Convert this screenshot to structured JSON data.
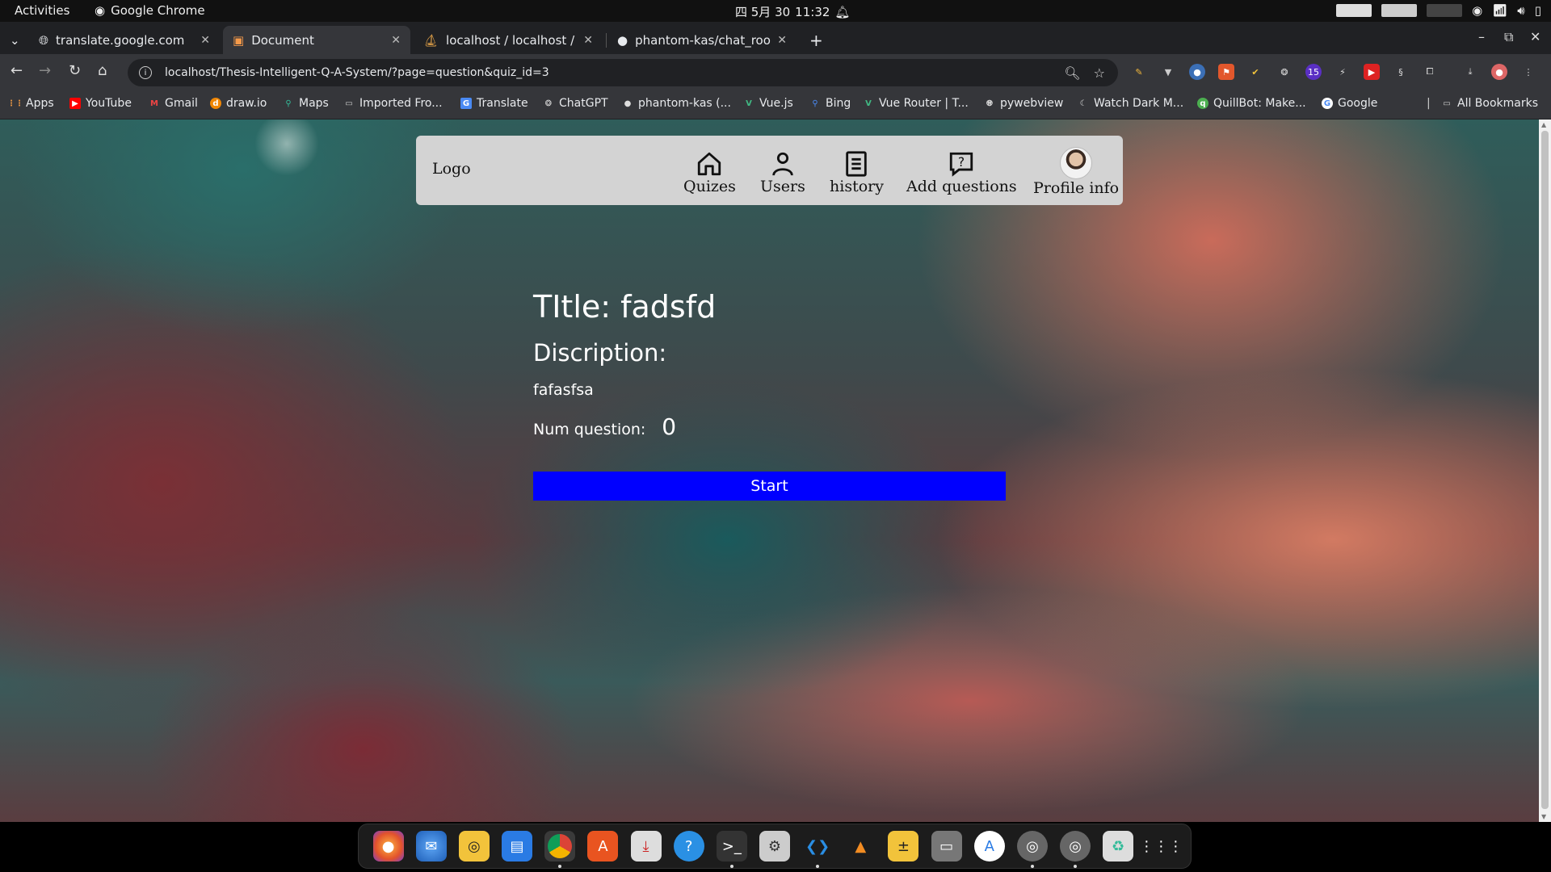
{
  "system": {
    "activities": "Activities",
    "app_name": "Google Chrome",
    "date": "四 5月 30",
    "time": "11:32"
  },
  "browser": {
    "tabs": [
      {
        "title": "translate.google.com",
        "active": false
      },
      {
        "title": "Document",
        "active": true
      },
      {
        "title": "localhost / localhost / qa",
        "active": false
      },
      {
        "title": "phantom-kas/chat_room",
        "active": false
      }
    ],
    "url": "localhost/Thesis-Intelligent-Q-A-System/?page=question&quiz_id=3",
    "extension_badge": "15",
    "bookmarks": [
      {
        "label": "Apps",
        "icon": "apps-grid-icon"
      },
      {
        "label": "YouTube",
        "icon": "youtube-icon"
      },
      {
        "label": "Gmail",
        "icon": "gmail-icon"
      },
      {
        "label": "draw.io",
        "icon": "drawio-icon"
      },
      {
        "label": "Maps",
        "icon": "maps-icon"
      },
      {
        "label": "Imported Fro...",
        "icon": "folder-icon"
      },
      {
        "label": "Translate",
        "icon": "translate-icon"
      },
      {
        "label": "ChatGPT",
        "icon": "chatgpt-icon"
      },
      {
        "label": "phantom-kas (...",
        "icon": "github-icon"
      },
      {
        "label": "Vue.js",
        "icon": "vue-icon"
      },
      {
        "label": "Bing",
        "icon": "bing-icon"
      },
      {
        "label": "Vue Router | T...",
        "icon": "vue-icon"
      },
      {
        "label": "pywebview",
        "icon": "globe-icon"
      },
      {
        "label": "Watch Dark M...",
        "icon": "site-icon"
      },
      {
        "label": "QuillBot: Make...",
        "icon": "quillbot-icon"
      },
      {
        "label": "Google",
        "icon": "google-icon"
      }
    ],
    "all_bookmarks": "All Bookmarks"
  },
  "site_nav": {
    "logo": "Logo",
    "items": [
      {
        "label": "Quizes",
        "icon": "home-icon"
      },
      {
        "label": "Users",
        "icon": "user-icon"
      },
      {
        "label": "history",
        "icon": "list-icon"
      },
      {
        "label": "Add questions",
        "icon": "question-icon"
      },
      {
        "label": "Profile info",
        "icon": "avatar"
      }
    ]
  },
  "quiz": {
    "title": "TItle: fadsfd",
    "description_label": "Discription:",
    "description": "fafasfsa",
    "num_question_label": "Num question:",
    "num_question_value": "0",
    "start_label": "Start"
  },
  "dock_apps": [
    "firefox",
    "thunderbird",
    "rhythmbox",
    "writer",
    "chrome",
    "software",
    "installer",
    "help",
    "terminal",
    "settings",
    "vscode",
    "vlc",
    "calculator",
    "files",
    "app-center",
    "disk-1",
    "disk-2",
    "trash",
    "show-apps"
  ],
  "colors": {
    "start_button": "#0000ff",
    "nav_background": "#d3d3d3"
  }
}
